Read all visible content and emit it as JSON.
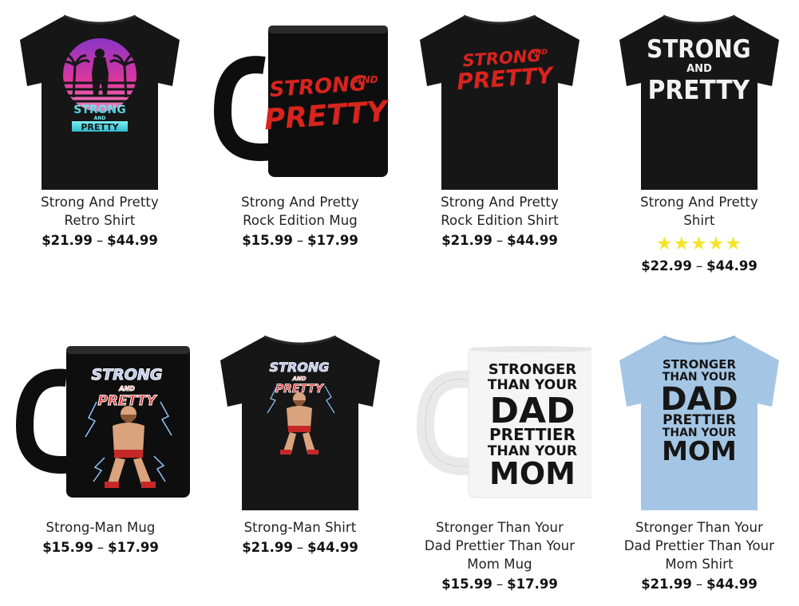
{
  "products": [
    {
      "title_1": "Strong And Pretty",
      "title_2": "Retro Shirt",
      "title_3": "",
      "price_min": "$21.99",
      "price_max": "$44.99",
      "art": [
        "STRONG",
        "AND",
        "PRETTY"
      ]
    },
    {
      "title_1": "Strong And Pretty",
      "title_2": "Rock Edition Mug",
      "title_3": "",
      "price_min": "$15.99",
      "price_max": "$17.99",
      "art": [
        "STRONG",
        "AND",
        "PRETTY"
      ]
    },
    {
      "title_1": "Strong And Pretty",
      "title_2": "Rock Edition Shirt",
      "title_3": "",
      "price_min": "$21.99",
      "price_max": "$44.99",
      "art": [
        "STRONG",
        "AND",
        "PRETTY"
      ]
    },
    {
      "title_1": "Strong And Pretty",
      "title_2": "Shirt",
      "title_3": "",
      "price_min": "$22.99",
      "price_max": "$44.99",
      "rating": 5,
      "stars": "★★★★★",
      "art": [
        "STRONG",
        "AND",
        "PRETTY"
      ]
    },
    {
      "title_1": "Strong-Man Mug",
      "title_2": "",
      "title_3": "",
      "price_min": "$15.99",
      "price_max": "$17.99",
      "art": [
        "STRONG",
        "AND",
        "PRETTY"
      ]
    },
    {
      "title_1": "Strong-Man Shirt",
      "title_2": "",
      "title_3": "",
      "price_min": "$21.99",
      "price_max": "$44.99",
      "art": [
        "STRONG",
        "AND",
        "PRETTY"
      ]
    },
    {
      "title_1": "Stronger Than Your",
      "title_2": "Dad Prettier Than Your",
      "title_3": "Mom Mug",
      "price_min": "$15.99",
      "price_max": "$17.99",
      "art": [
        "STRONGER",
        "THAN YOUR",
        "DAD",
        "PRETTIER",
        "THAN YOUR",
        "MOM"
      ]
    },
    {
      "title_1": "Stronger Than Your",
      "title_2": "Dad Prettier Than Your",
      "title_3": "Mom Shirt",
      "price_min": "$21.99",
      "price_max": "$44.99",
      "art": [
        "STRONGER",
        "THAN YOUR",
        "DAD",
        "PRETTIER",
        "THAN YOUR",
        "MOM"
      ]
    }
  ],
  "price_separator": "–",
  "colors": {
    "shirt_black": "#161616",
    "shirt_blue": "#a4c6e4",
    "mug_black": "#0e0e0e",
    "mug_white": "#f5f5f5",
    "rock_red": "#d8241e",
    "retro_pink": "#d9359b",
    "retro_cyan": "#5fe0e8",
    "star_yellow": "#f5e52a"
  }
}
